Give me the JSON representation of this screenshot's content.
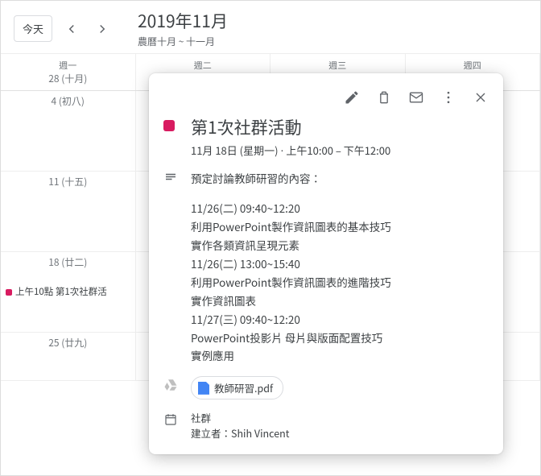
{
  "header": {
    "today_label": "今天",
    "title": "2019年11月",
    "subtitle": "農曆十月 ~ 十一月"
  },
  "weekdays": [
    "週一",
    "週二",
    "週三",
    "週四"
  ],
  "weekdates": [
    "28 (十月)",
    "",
    "",
    ""
  ],
  "weeks": [
    {
      "mon": "4 (初八)",
      "tue": "",
      "wed": "",
      "thu": ""
    },
    {
      "mon": "11 (十五)",
      "tue": "",
      "wed": "",
      "thu": ""
    },
    {
      "mon": "18 (廿二)",
      "tue": "",
      "wed": "",
      "thu": "",
      "event": "上午10點 第1次社群活"
    },
    {
      "mon": "25 (廿九)",
      "tue": "",
      "wed": "",
      "thu": ""
    }
  ],
  "popup": {
    "title": "第1次社群活動",
    "datetime": "11月 18日 (星期一) ⋅ 上午10:00 – 下午12:00",
    "desc_intro": "預定討論教師研習的內容：",
    "desc_body": "11/26(二) 09:40~12:20\n利用PowerPoint製作資訊圖表的基本技巧\n實作各類資訊呈現元素\n11/26(二) 13:00~15:40\n利用PowerPoint製作資訊圖表的進階技巧\n實作資訊圖表\n11/27(三) 09:40~12:20\nPowerPoint投影片 母片與版面配置技巧\n實例應用",
    "attachment": "教師研習.pdf",
    "calendar": "社群",
    "creator_label": "建立者：",
    "creator": "Shih Vincent",
    "color": "#d81b60"
  }
}
